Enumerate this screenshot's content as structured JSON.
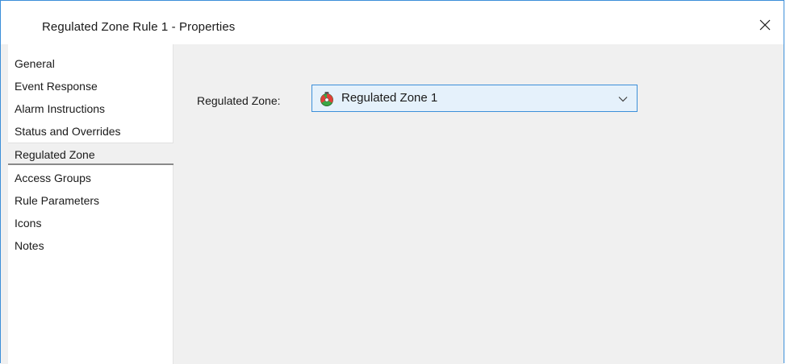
{
  "window": {
    "title": "Regulated Zone Rule 1 - Properties",
    "close_icon": "close-icon"
  },
  "nav": {
    "items": [
      {
        "label": "General",
        "selected": false
      },
      {
        "label": "Event Response",
        "selected": false
      },
      {
        "label": "Alarm Instructions",
        "selected": false
      },
      {
        "label": "Status and Overrides",
        "selected": false
      },
      {
        "label": "Regulated Zone",
        "selected": true
      },
      {
        "label": "Access Groups",
        "selected": false
      },
      {
        "label": "Rule Parameters",
        "selected": false
      },
      {
        "label": "Icons",
        "selected": false
      },
      {
        "label": "Notes",
        "selected": false
      }
    ]
  },
  "regulated_zone": {
    "label": "Regulated Zone:",
    "value": "Regulated Zone 1",
    "icon": "regulated-zone-icon",
    "dropdown_icon": "chevron-down-icon"
  },
  "colors": {
    "accent": "#3c8fd9",
    "combo_background": "#e5f1fb",
    "panel_background": "#f0f0f0",
    "zone_icon_red": "#e0403a",
    "zone_icon_green": "#3aa845"
  }
}
